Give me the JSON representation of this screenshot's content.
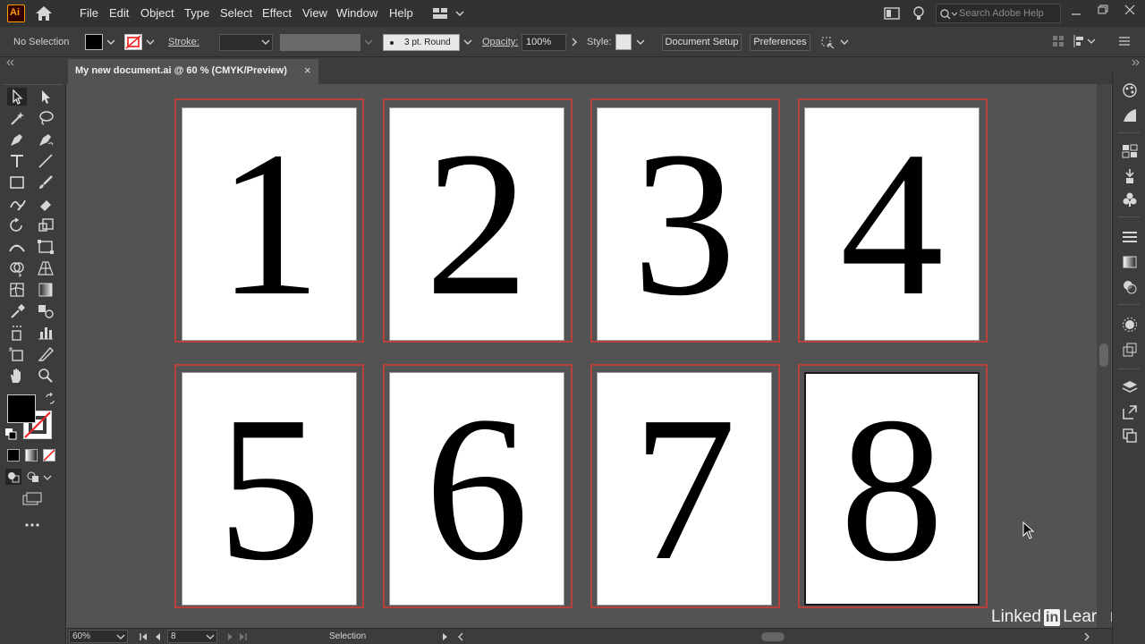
{
  "app": {
    "logo": "Ai"
  },
  "menu": [
    "File",
    "Edit",
    "Object",
    "Type",
    "Select",
    "Effect",
    "View",
    "Window",
    "Help"
  ],
  "search": {
    "placeholder": "Search Adobe Help"
  },
  "control": {
    "selection": "No Selection",
    "stroke_label": "Stroke:",
    "brush": "3 pt. Round",
    "opacity_label": "Opacity:",
    "opacity_value": "100%",
    "style_label": "Style:",
    "document_setup": "Document Setup",
    "preferences": "Preferences"
  },
  "tab": {
    "title": "My new document.ai @ 60 % (CMYK/Preview)",
    "close": "×"
  },
  "artboards": [
    "1",
    "2",
    "3",
    "4",
    "5",
    "6",
    "7",
    "8"
  ],
  "status": {
    "zoom": "60%",
    "artboard_number": "8",
    "tool": "Selection"
  },
  "watermark": {
    "text1": "Linked",
    "text_in": "in",
    "text2": "Learning"
  },
  "colors": {
    "frame_red": "#b9413c",
    "ui_dark": "#323232",
    "panel": "#3c3c3c",
    "canvas": "#535353",
    "ai_orange": "#ff9a00"
  }
}
